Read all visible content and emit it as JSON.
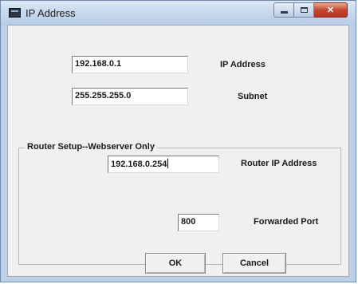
{
  "window": {
    "title": "IP Address",
    "app_icon": "window-app-icon",
    "caption_buttons": {
      "minimize": "minimize-icon",
      "maximize": "maximize-icon",
      "close": "close-icon"
    }
  },
  "ip": {
    "value": "192.168.0.1",
    "label": "IP Address"
  },
  "subnet": {
    "value": "255.255.255.0",
    "label": "Subnet"
  },
  "router_group": {
    "title": "Router Setup--Webserver Only",
    "router_ip": {
      "value": "192.168.0.254",
      "label": "Router IP Address"
    },
    "port": {
      "value": "800",
      "label": "Forwarded Port"
    }
  },
  "buttons": {
    "ok": "OK",
    "cancel": "Cancel"
  },
  "colors": {
    "title_bar": "#c7d9ee",
    "close_button": "#c4462f",
    "dialog_face": "#f0f0f0"
  }
}
